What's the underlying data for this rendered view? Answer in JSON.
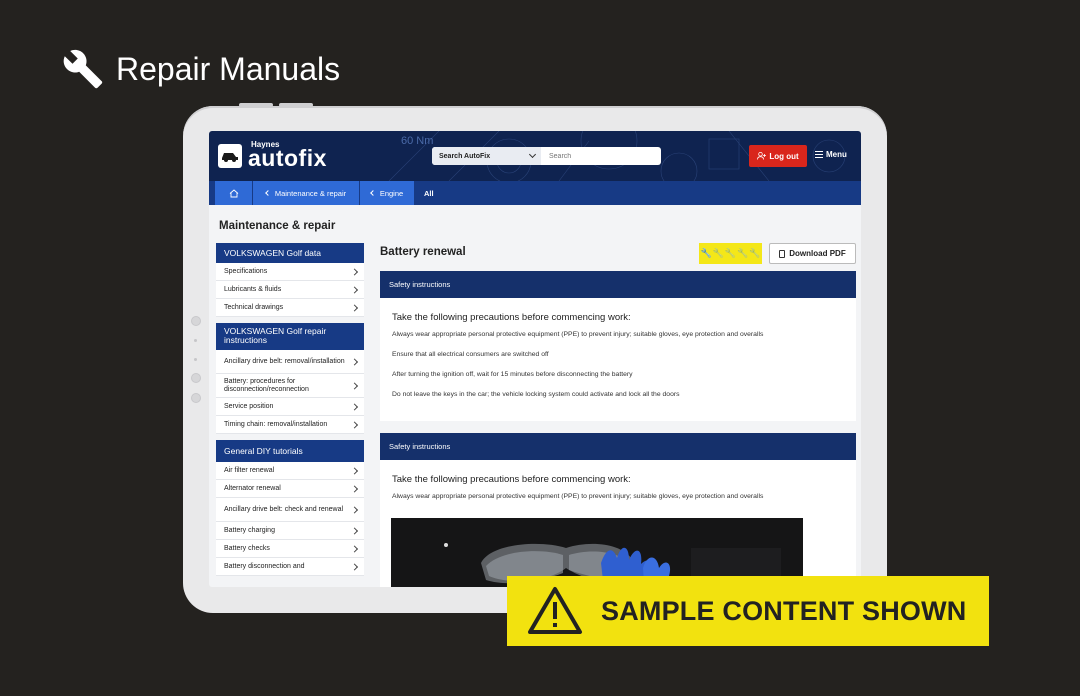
{
  "hero": {
    "title": "Repair Manuals",
    "icon": "wrench-icon"
  },
  "header": {
    "brand_small": "Haynes",
    "brand_big": "autofix",
    "decor_text": "60 Nm",
    "search_select": "Search AutoFix",
    "search_placeholder": "Search",
    "logout_label": "Log out",
    "menu_label": "Menu",
    "colors": {
      "navy": "#0f2350",
      "logout": "#d9261c",
      "crumb": "#2f6ad6"
    }
  },
  "breadcrumb": [
    "Maintenance & repair",
    "Engine",
    "All"
  ],
  "page_heading": "Maintenance & repair",
  "sidebar": {
    "sections": [
      {
        "title": "VOLKSWAGEN Golf data",
        "items": [
          "Specifications",
          "Lubricants & fluids",
          "Technical drawings"
        ]
      },
      {
        "title": "VOLKSWAGEN Golf repair instructions",
        "items": [
          "Ancillary drive belt: removal/installation",
          "Battery: procedures for disconnection/reconnection",
          "Service position",
          "Timing chain: removal/installation"
        ]
      },
      {
        "title": "General DIY tutorials",
        "items": [
          "Air filter renewal",
          "Alternator renewal",
          "Ancillary drive belt: check and renewal",
          "Battery charging",
          "Battery checks",
          "Battery disconnection and"
        ]
      }
    ]
  },
  "article": {
    "title": "Battery renewal",
    "difficulty_rating": 1,
    "difficulty_max": 5,
    "download_label": "Download PDF",
    "cards": [
      {
        "bar": "Safety instructions",
        "heading": "Take the following precautions before commencing work:",
        "lines": [
          "Always wear appropriate personal protective equipment (PPE) to prevent injury; suitable gloves, eye protection and overalls",
          "Ensure that all electrical consumers are switched off",
          "After turning the ignition off, wait for 15 minutes before disconnecting the battery",
          "Do not leave the keys in the car; the vehicle locking system could activate and lock all the doors"
        ]
      },
      {
        "bar": "Safety instructions",
        "heading": "Take the following precautions before commencing work:",
        "lines": [
          "Always wear appropriate personal protective equipment (PPE) to prevent injury; suitable gloves, eye protection and overalls"
        ]
      }
    ]
  },
  "banner": {
    "text": "SAMPLE CONTENT SHOWN",
    "color": "#f2e20f",
    "icon": "warning-icon"
  }
}
